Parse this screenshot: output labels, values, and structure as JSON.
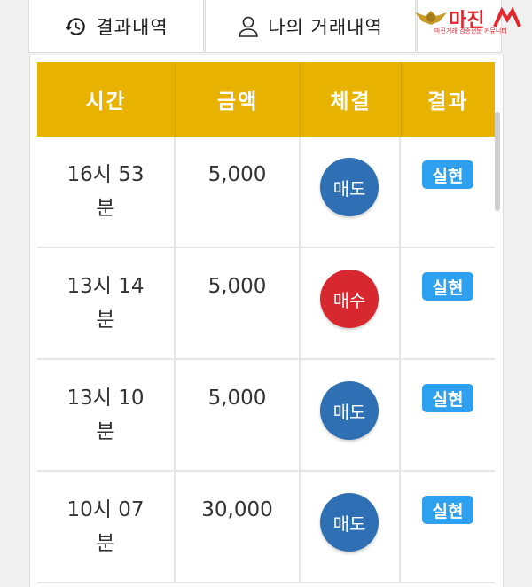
{
  "tabs": [
    {
      "label": "결과내역",
      "icon": "history-icon"
    },
    {
      "label": "나의 거래내역",
      "icon": "user-icon"
    }
  ],
  "logo": {
    "text": "마진",
    "subtitle": "마진거래 검증전문 커뮤니티",
    "badge_color": "#e3262d"
  },
  "table": {
    "headers": [
      "시간",
      "금액",
      "체결",
      "결과"
    ],
    "rows": [
      {
        "time": "16시 53\n분",
        "amount": "5,000",
        "trade": "매도",
        "trade_type": "sell",
        "result": "실현"
      },
      {
        "time": "13시 14\n분",
        "amount": "5,000",
        "trade": "매수",
        "trade_type": "buy",
        "result": "실현"
      },
      {
        "time": "13시 10\n분",
        "amount": "5,000",
        "trade": "매도",
        "trade_type": "sell",
        "result": "실현"
      },
      {
        "time": "10시 07\n분",
        "amount": "30,000",
        "trade": "매도",
        "trade_type": "sell",
        "result": "실현"
      }
    ]
  },
  "colors": {
    "header_bg": "#e8b300",
    "sell": "#2f6fb3",
    "buy": "#d7282f",
    "badge": "#2da0f0"
  }
}
